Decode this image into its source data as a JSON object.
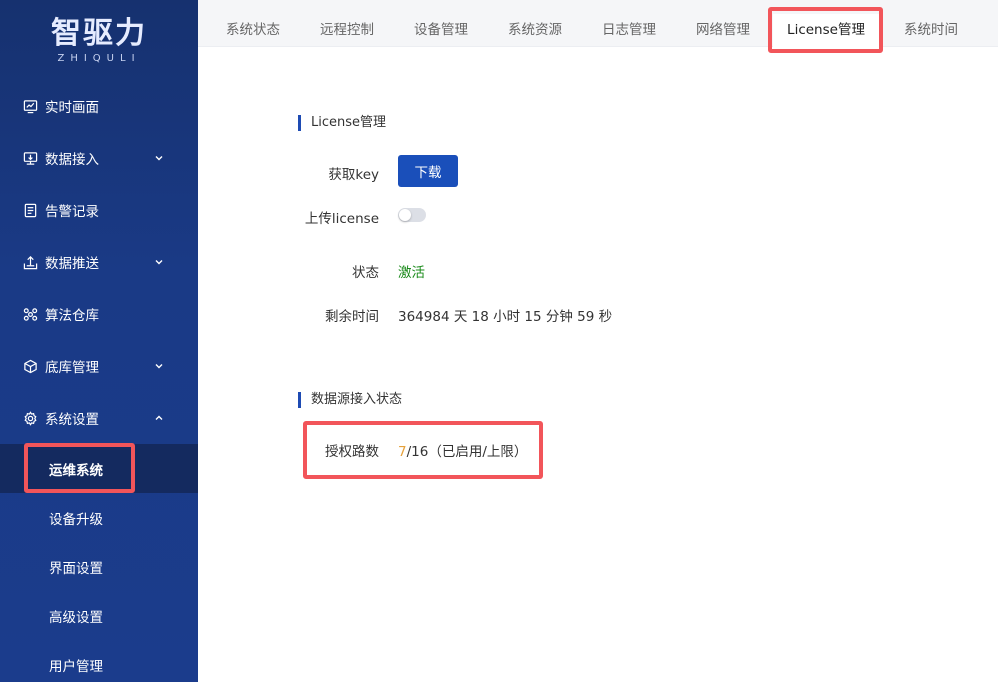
{
  "brand": {
    "name": "智驱力",
    "sub": "ZHIQULI"
  },
  "sidebar": {
    "items": [
      {
        "label": "实时画面",
        "icon": "monitor-chart-icon",
        "has_arrow": false
      },
      {
        "label": "数据接入",
        "icon": "data-input-icon",
        "has_arrow": true
      },
      {
        "label": "告警记录",
        "icon": "document-list-icon",
        "has_arrow": false
      },
      {
        "label": "数据推送",
        "icon": "upload-tray-icon",
        "has_arrow": true
      },
      {
        "label": "算法仓库",
        "icon": "algorithm-icon",
        "has_arrow": false
      },
      {
        "label": "底库管理",
        "icon": "cube-icon",
        "has_arrow": true
      },
      {
        "label": "系统设置",
        "icon": "gear-icon",
        "has_arrow": true,
        "expanded": true
      }
    ],
    "submenu": [
      {
        "label": "运维系统",
        "active": true
      },
      {
        "label": "设备升级"
      },
      {
        "label": "界面设置"
      },
      {
        "label": "高级设置"
      },
      {
        "label": "用户管理"
      }
    ]
  },
  "tabs": [
    {
      "label": "系统状态"
    },
    {
      "label": "远程控制"
    },
    {
      "label": "设备管理"
    },
    {
      "label": "系统资源"
    },
    {
      "label": "日志管理"
    },
    {
      "label": "网络管理"
    },
    {
      "label": "License管理",
      "active": true
    },
    {
      "label": "系统时间"
    }
  ],
  "license": {
    "section_title": "License管理",
    "get_key_label": "获取key",
    "download_label": "下载",
    "upload_label": "上传license",
    "upload_enabled": false,
    "status_label": "状态",
    "status_value": "激活",
    "remaining_label": "剩余时间",
    "remaining_value": "364984 天 18 小时 15 分钟 59 秒"
  },
  "datasource": {
    "section_title": "数据源接入状态",
    "auth_label": "授权路数",
    "used": "7",
    "rest": "/16（已启用/上限）"
  },
  "colors": {
    "sidebar_bg": "#1a3a86",
    "primary": "#1a4fba",
    "highlight": "#f2555a",
    "status_active": "#1a8a1a",
    "used_count": "#e6a23c"
  }
}
